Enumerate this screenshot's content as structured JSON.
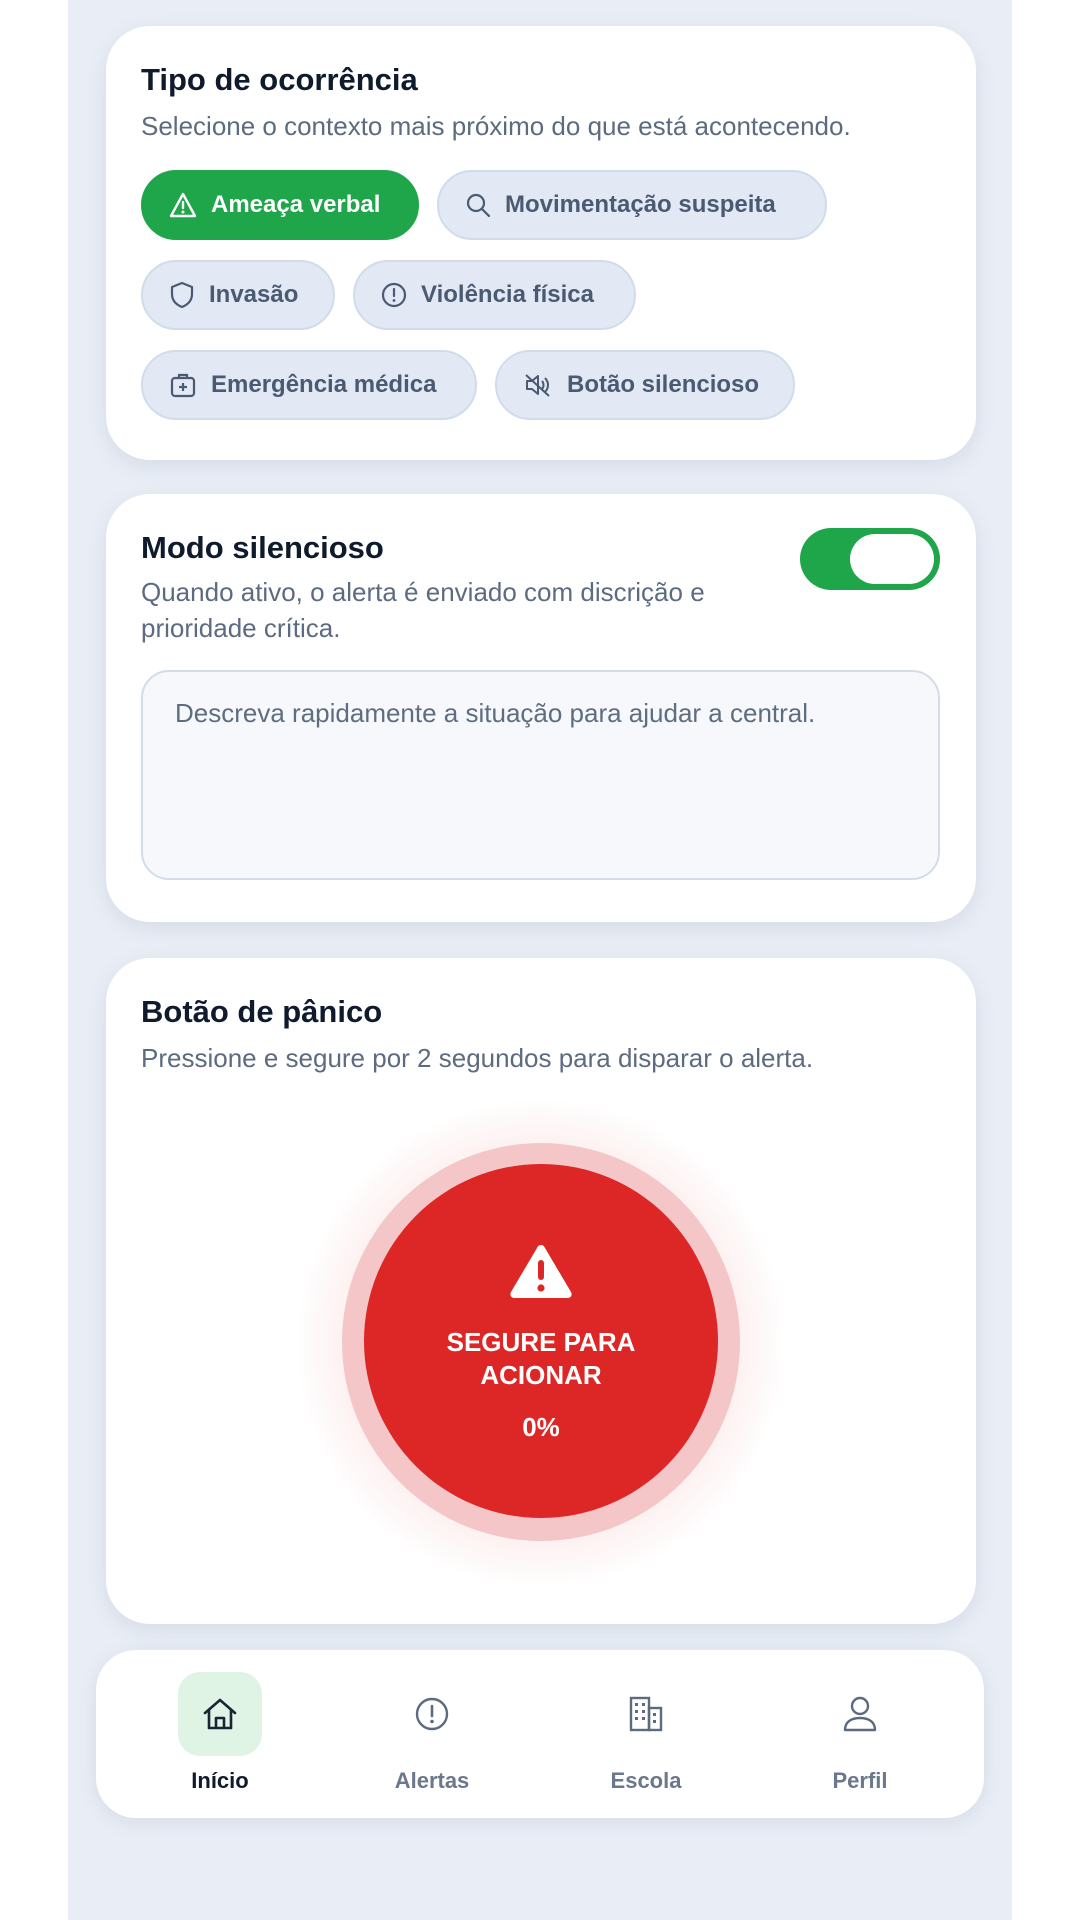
{
  "occurrence": {
    "title": "Tipo de ocorrência",
    "subtitle": "Selecione o contexto mais próximo do que está acontecendo.",
    "chips": [
      {
        "label": "Ameaça verbal",
        "icon": "warning-triangle-icon",
        "selected": true
      },
      {
        "label": "Movimentação suspeita",
        "icon": "search-icon",
        "selected": false
      },
      {
        "label": "Invasão",
        "icon": "shield-icon",
        "selected": false
      },
      {
        "label": "Violência física",
        "icon": "alert-circle-icon",
        "selected": false
      },
      {
        "label": "Emergência médica",
        "icon": "medical-kit-icon",
        "selected": false
      },
      {
        "label": "Botão silencioso",
        "icon": "muted-speaker-icon",
        "selected": false
      }
    ]
  },
  "silent_mode": {
    "title": "Modo silencioso",
    "subtitle": "Quando ativo, o alerta é enviado com discrição e prioridade crítica.",
    "enabled": true,
    "description_placeholder": "Descreva rapidamente a situação para ajudar a central."
  },
  "panic": {
    "title": "Botão de pânico",
    "subtitle": "Pressione e segure por 2 segundos para disparar o alerta.",
    "button_label": "SEGURE PARA ACIONAR",
    "progress": "0%",
    "icon": "warning-triangle-icon"
  },
  "nav": {
    "items": [
      {
        "label": "Início",
        "icon": "home-icon",
        "active": true
      },
      {
        "label": "Alertas",
        "icon": "alert-circle-icon",
        "active": false
      },
      {
        "label": "Escola",
        "icon": "building-icon",
        "active": false
      },
      {
        "label": "Perfil",
        "icon": "user-icon",
        "active": false
      }
    ]
  },
  "colors": {
    "accent_green": "#1fa54a",
    "panic_red": "#dd2626",
    "background": "#e9eef6"
  }
}
